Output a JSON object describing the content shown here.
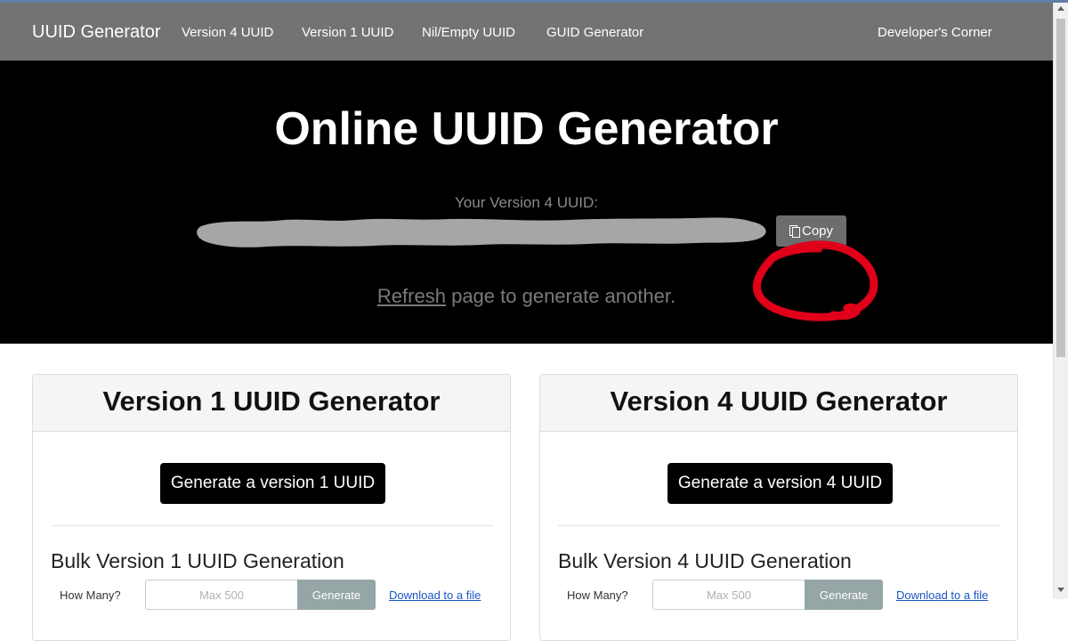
{
  "nav": {
    "brand": "UUID Generator",
    "items": [
      {
        "label": "Version 4 UUID"
      },
      {
        "label": "Version 1 UUID"
      },
      {
        "label": "Nil/Empty UUID"
      },
      {
        "label": "GUID Generator"
      }
    ],
    "right": "Developer's Corner"
  },
  "hero": {
    "title": "Online UUID Generator",
    "uuid_label": "Your Version 4 UUID:",
    "copy_label": "Copy",
    "copy_icon": "clipboard-icon",
    "refresh_link": "Refresh",
    "refresh_text": " page to generate another."
  },
  "cards": [
    {
      "title": "Version 1 UUID Generator",
      "button": "Generate a version 1 UUID",
      "bulk_title": "Bulk Version 1 UUID Generation",
      "how_many": "How Many?",
      "placeholder": "Max 500",
      "generate": "Generate",
      "download": "Download to a file"
    },
    {
      "title": "Version 4 UUID Generator",
      "button": "Generate a version 4 UUID",
      "bulk_title": "Bulk Version 4 UUID Generation",
      "how_many": "How Many?",
      "placeholder": "Max 500",
      "generate": "Generate",
      "download": "Download to a file"
    }
  ],
  "colors": {
    "navbar": "#737373",
    "hero": "#000000",
    "annotation": "#e0001a",
    "redaction": "#a5a6a8",
    "link": "#1a55c4"
  }
}
